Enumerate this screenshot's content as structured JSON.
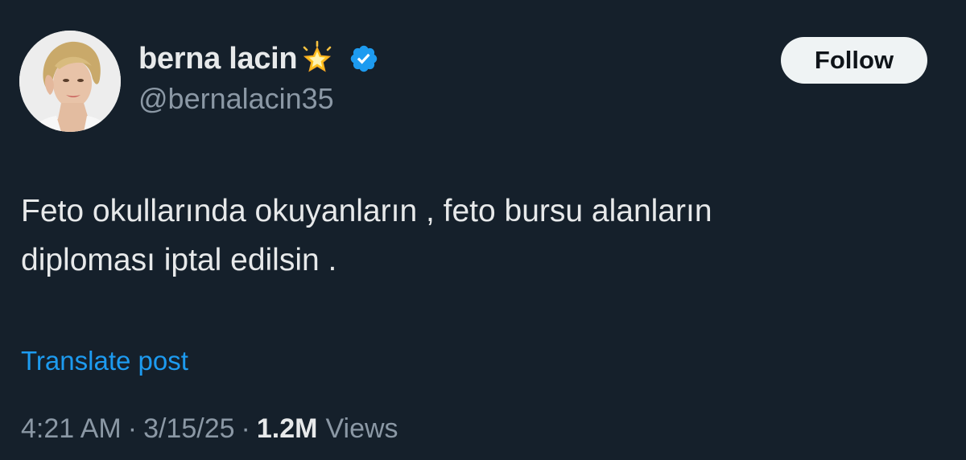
{
  "author": {
    "display_name": "berna lacin",
    "handle": "@bernalacin35",
    "avatar_icon": "avatar-photo",
    "name_emoji_icon": "glowing-star-icon",
    "verified_icon": "verified-badge-icon",
    "verified_color": "#1d9bf0"
  },
  "follow_button": {
    "label": "Follow"
  },
  "post": {
    "text_lines": [
      "Feto okullarında okuyanların , feto bursu alanların",
      "diploması iptal edilsin ."
    ],
    "translate_label": "Translate post"
  },
  "meta": {
    "time": "4:21 AM",
    "date": "3/15/25",
    "separator": "·",
    "views_count": "1.2M",
    "views_label": "Views"
  },
  "colors": {
    "background": "#15202b",
    "primary_text": "#e7e9ea",
    "secondary_text": "#8b98a5",
    "link": "#1d9bf0",
    "button_bg": "#eff3f4"
  }
}
